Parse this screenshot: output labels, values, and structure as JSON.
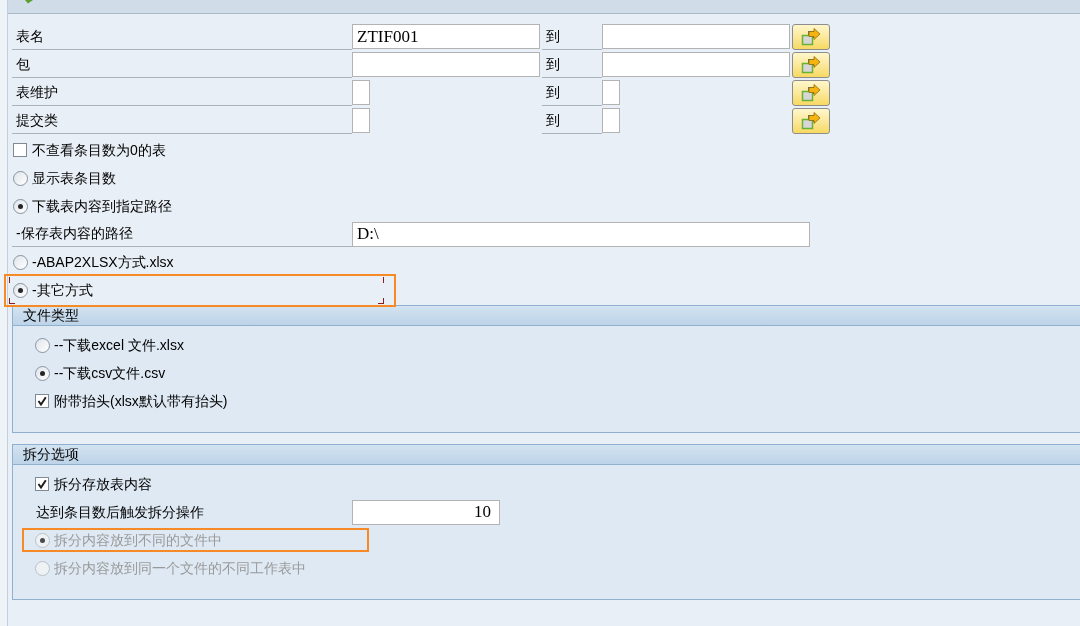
{
  "selection_rows": [
    {
      "label": "表名",
      "kind": "wide",
      "low_value": "ZTIF001",
      "to_label": "到"
    },
    {
      "label": "包",
      "kind": "wide",
      "to_label": "到"
    },
    {
      "label": "表维护",
      "kind": "narrow",
      "to_label": "到"
    },
    {
      "label": "提交类",
      "kind": "narrow",
      "to_label": "到"
    }
  ],
  "options": [
    {
      "kind": "checkbox",
      "label": "不查看条目数为0的表",
      "checked": false
    },
    {
      "kind": "radio",
      "label": "显示表条目数",
      "selected": false,
      "focused": false,
      "highlighted": false
    },
    {
      "kind": "radio",
      "label": "下载表内容到指定路径",
      "selected": true,
      "focused": false,
      "highlighted": false
    },
    {
      "kind": "input",
      "label": "-保存表内容的路径",
      "value": "D:\\"
    },
    {
      "kind": "radio",
      "label": "-ABAP2XLSX方式.xlsx",
      "selected": false,
      "focused": false,
      "highlighted": false
    },
    {
      "kind": "radio",
      "label": "-其它方式",
      "selected": true,
      "focused": true,
      "highlighted": true
    }
  ],
  "groups": [
    {
      "title": "文件类型",
      "items": [
        {
          "kind": "radio",
          "label": "--下载excel 文件.xlsx",
          "selected": false,
          "focused": false,
          "highlighted": false
        },
        {
          "kind": "radio",
          "label": "--下载csv文件.csv",
          "selected": true,
          "focused": false,
          "highlighted": false
        },
        {
          "kind": "checkbox",
          "label": "附带抬头(xlsx默认带有抬头)",
          "checked": true
        }
      ]
    },
    {
      "title": "拆分选项",
      "items": [
        {
          "kind": "checkbox",
          "label": "拆分存放表内容",
          "checked": true,
          "disabled": false
        },
        {
          "kind": "number",
          "label": "达到条目数后触发拆分操作",
          "value": "10",
          "disabled": false
        },
        {
          "kind": "radio",
          "label": "拆分内容放到不同的文件中",
          "selected": true,
          "disabled": true,
          "focused": false,
          "highlighted": true
        },
        {
          "kind": "radio",
          "label": "拆分内容放到同一个文件的不同工作表中",
          "selected": false,
          "disabled": true,
          "focused": false,
          "highlighted": false
        }
      ]
    }
  ]
}
